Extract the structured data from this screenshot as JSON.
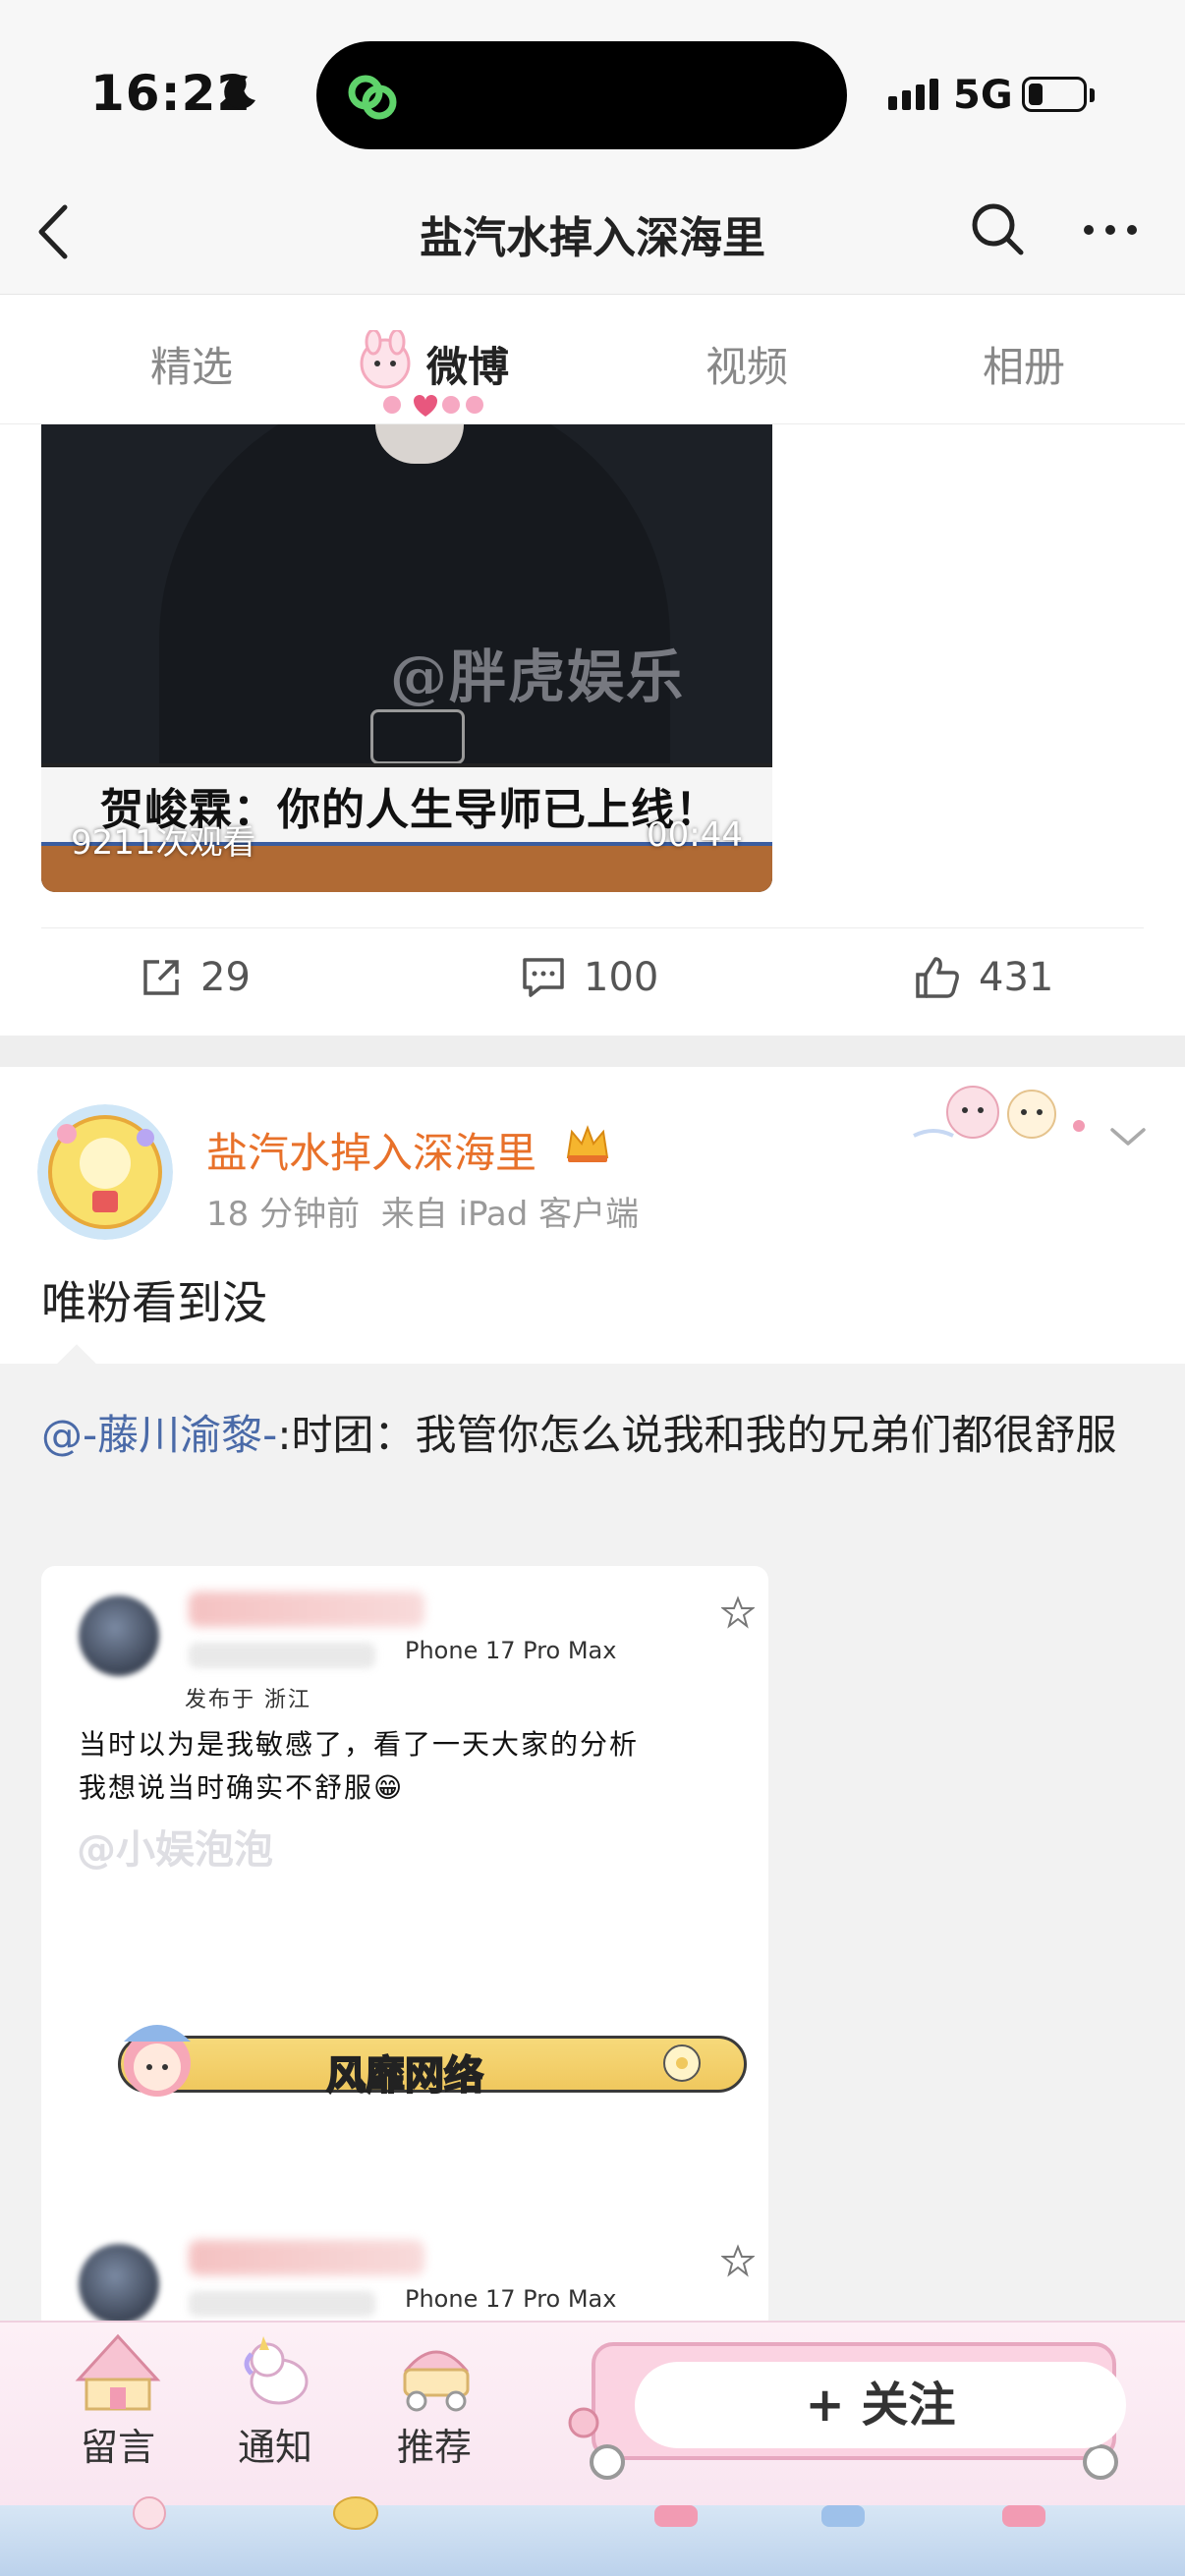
{
  "status_bar": {
    "time": "16:22",
    "network": "5G",
    "battery_level": 0.25
  },
  "header": {
    "title": "盐汽水掉入深海里",
    "back_icon": "chevron-left-icon",
    "search_icon": "search-icon",
    "more_icon": "more-icon"
  },
  "tabs": [
    {
      "label": "精选",
      "active": false
    },
    {
      "label": "微博",
      "active": true
    },
    {
      "label": "视频",
      "active": false
    },
    {
      "label": "相册",
      "active": false
    }
  ],
  "video_post": {
    "watermark": "@胖虎娱乐",
    "caption": "贺峻霖：你的人生导师已上线！",
    "views": "9211次观看",
    "duration": "00:44",
    "actions": {
      "repost_count": "29",
      "comment_count": "100",
      "like_count": "431"
    }
  },
  "post": {
    "author": "盐汽水掉入深海里",
    "time": "18 分钟前",
    "source": "来自 iPad 客户端",
    "text": "唯粉看到没",
    "repost": {
      "mention": "@-藤川渝黎-",
      "text": ":时团：我管你怎么说我和我的兄弟们都很舒服"
    },
    "image": {
      "device": "Phone 17 Pro Max",
      "publish_location": "发布于 浙江",
      "handwritten_line_1": "当时以为是我敏感了，看了一天大家的分析",
      "handwritten_line_2": "我想说当时确实不舒服😁",
      "watermark": "@小娱泡泡",
      "banner_label": "风靡网络",
      "device_2": "Phone 17 Pro Max"
    }
  },
  "bottom_bar": {
    "message_label": "留言",
    "notify_label": "通知",
    "recommend_label": "推荐",
    "follow_label": "+ 关注"
  },
  "colors": {
    "author_orange": "#e8712a",
    "mention_blue": "#4a6aa8",
    "background_gray": "#f7f7f7"
  }
}
